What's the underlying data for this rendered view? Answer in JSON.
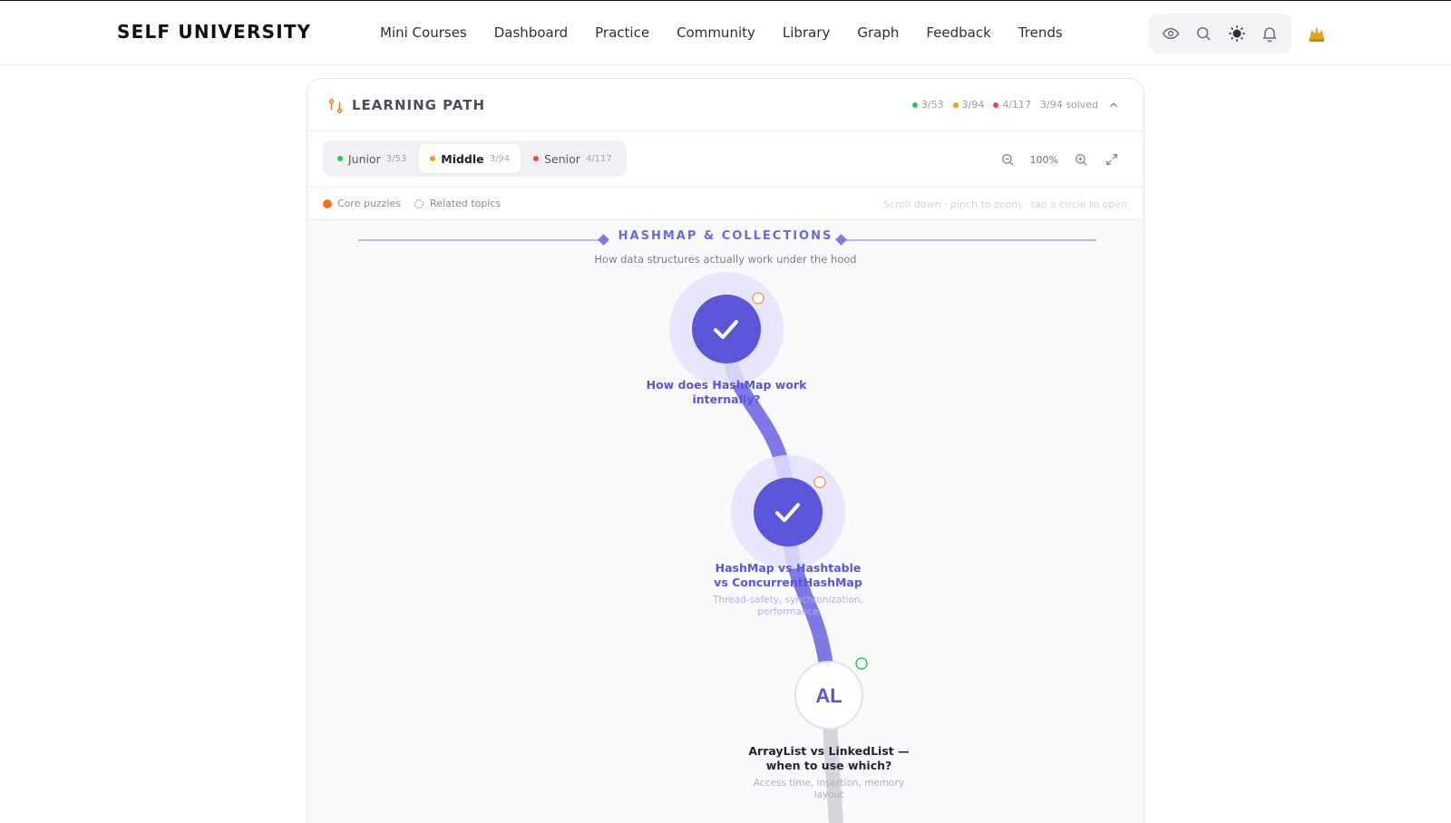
{
  "brand": "SELF UNIVERSITY",
  "nav": [
    "Mini Courses",
    "Dashboard",
    "Practice",
    "Community",
    "Library",
    "Graph",
    "Feedback",
    "Trends"
  ],
  "tools": [
    "eye-icon",
    "search-icon",
    "sun-icon",
    "bell-icon"
  ],
  "avatar_icon": "crown-avatar-icon",
  "panel": {
    "title": "LEARNING PATH",
    "stats": [
      {
        "color": "#22c55e",
        "text": "3/53"
      },
      {
        "color": "#f59e0b",
        "text": "3/94"
      },
      {
        "color": "#ef4444",
        "text": "4/117"
      }
    ],
    "solved": "3/94 solved",
    "levels": [
      {
        "label": "Junior",
        "count": "3/53",
        "color": "#22c55e",
        "active": false
      },
      {
        "label": "Middle",
        "count": "3/94",
        "color": "#f59e0b",
        "active": true
      },
      {
        "label": "Senior",
        "count": "4/117",
        "color": "#ef4444",
        "active": false
      }
    ],
    "zoom": "100%",
    "legend": {
      "core": "Core puzzles",
      "related": "Related topics"
    },
    "hint": "Scroll down · pinch to zoom · tap a circle to open"
  },
  "section": {
    "title": "HASHMAP & COLLECTIONS",
    "subtitle": "How data structures actually work under the hood"
  },
  "nodes": [
    {
      "title": "How does HashMap work internally?",
      "desc": "",
      "status": "done",
      "badge": "",
      "ring": "#f5a35f"
    },
    {
      "title": "HashMap vs Hashtable vs ConcurrentHashMap",
      "desc": "Thread-safety, synchronization, performance",
      "status": "done",
      "badge": "",
      "ring": "#f5a35f"
    },
    {
      "title": "ArrayList vs LinkedList — when to use which?",
      "desc": "Access time, insertion, memory layout",
      "status": "todo",
      "badge": "AL",
      "ring": "#34c759"
    }
  ],
  "colors": {
    "accent": "#5b55d9",
    "path": "#7f79e6",
    "brand_orange": "#f97316"
  }
}
